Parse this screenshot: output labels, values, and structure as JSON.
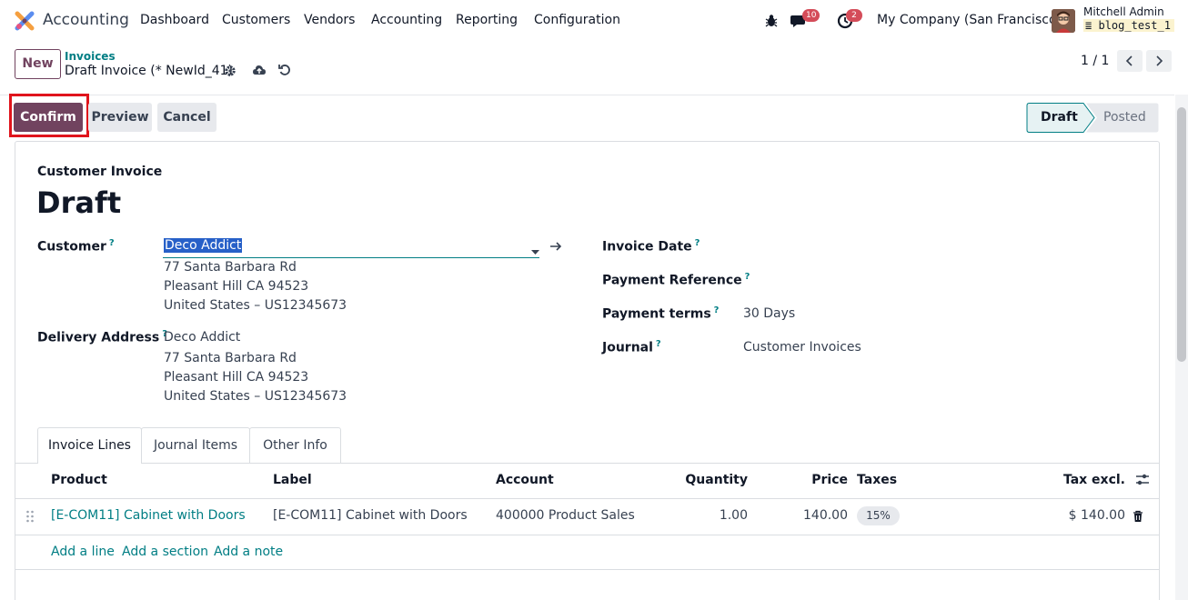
{
  "navbar": {
    "app_name": "Accounting",
    "menu": [
      "Dashboard",
      "Customers",
      "Vendors",
      "Accounting",
      "Reporting",
      "Configuration"
    ],
    "messages_count": "10",
    "activities_count": "2",
    "company": "My Company (San Francisco)",
    "user_name": "Mitchell Admin",
    "database": "blog_test_1"
  },
  "control_panel": {
    "new_label": "New",
    "breadcrumb_parent": "Invoices",
    "breadcrumb_current": "Draft Invoice (* NewId_41)",
    "pager": "1 / 1"
  },
  "actions": {
    "confirm": "Confirm",
    "preview": "Preview",
    "cancel": "Cancel"
  },
  "status": {
    "steps": [
      "Draft",
      "Posted"
    ],
    "active": "Draft"
  },
  "form": {
    "type_label": "Customer Invoice",
    "title": "Draft",
    "customer_label": "Customer",
    "customer_value": "Deco Addict",
    "customer_address": [
      "77 Santa Barbara Rd",
      "Pleasant Hill CA 94523",
      "United States – US12345673"
    ],
    "delivery_label": "Delivery Address",
    "delivery_address": [
      "Deco Addict",
      "77 Santa Barbara Rd",
      "Pleasant Hill CA 94523",
      "United States – US12345673"
    ],
    "invoice_date_label": "Invoice Date",
    "payment_reference_label": "Payment Reference",
    "payment_terms_label": "Payment terms",
    "payment_terms_value": "30 Days",
    "journal_label": "Journal",
    "journal_value": "Customer Invoices",
    "help_mark": "?"
  },
  "tabs": [
    "Invoice Lines",
    "Journal Items",
    "Other Info"
  ],
  "lines": {
    "columns": [
      "Product",
      "Label",
      "Account",
      "Quantity",
      "Price",
      "Taxes",
      "Tax excl."
    ],
    "rows": [
      {
        "product": "[E-COM11] Cabinet with Doors",
        "label": "[E-COM11] Cabinet with Doors",
        "account": "400000 Product Sales",
        "quantity": "1.00",
        "price": "140.00",
        "taxes": "15%",
        "subtotal": "$ 140.00"
      }
    ],
    "add_line": "Add a line",
    "add_section": "Add a section",
    "add_note": "Add a note"
  },
  "colors": {
    "brand": "#71435f",
    "link": "#017e84",
    "highlight": "#e0141c",
    "badge": "#d44c59"
  }
}
